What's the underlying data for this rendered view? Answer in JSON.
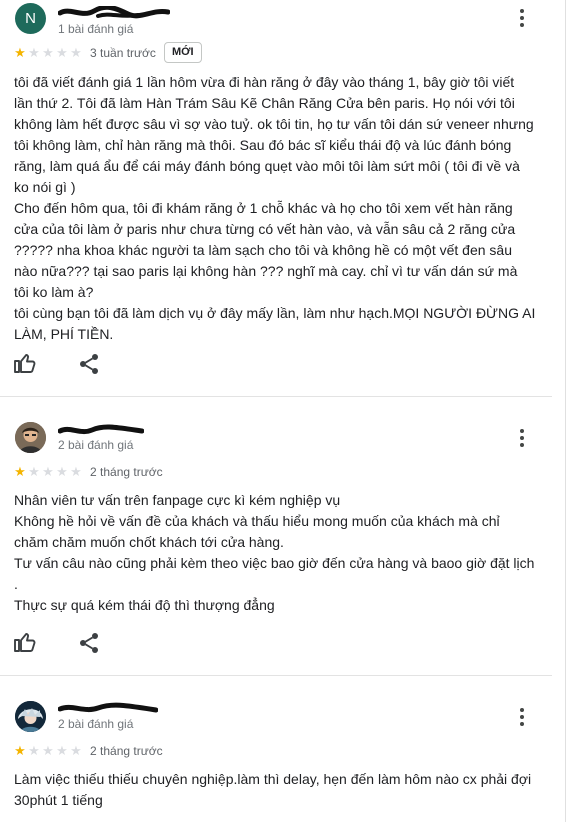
{
  "reviews": [
    {
      "avatar_letter": "N",
      "review_count": "1 bài đánh giá",
      "rating": 1,
      "time": "3 tuần trước",
      "badge": "MỚI",
      "text": "tôi đã viết đánh giá 1 lần hôm vừa đi hàn răng ở đây vào tháng 1, bây giờ tôi viết\nlần thứ 2. Tôi đã làm Hàn Trám Sâu Kẽ Chân Răng Cửa bên paris. Họ nói với tôi\nkhông làm hết được sâu vì sợ vào tuỷ. ok tôi tin, họ tư vấn tôi dán sứ veneer nhưng\ntôi không làm, chỉ hàn răng mà thôi. Sau đó bác sĩ kiểu thái độ và lúc đánh bóng\nrăng, làm quá ẩu để cái máy đánh bóng quẹt vào môi tôi làm sứt môi ( tôi đi về và\nko nói gì )\nCho đến hôm qua, tôi đi khám răng ở 1 chỗ khác và họ cho tôi xem vết hàn răng\ncửa của tôi làm ở paris như chưa từng có vết hàn vào, và vẫn sâu cả 2 răng cửa\n????? nha khoa khác người ta làm sạch cho tôi và không hề có một vết đen sâu\nnào nữa??? tại sao paris lại không hàn ??? nghĩ mà cay. chỉ vì tư vấn dán sứ mà\ntôi ko làm à?\ntôi cùng bạn tôi đã làm dịch vụ ở đây mấy lần, làm như hạch.MỌI NGƯỜI ĐỪNG AI\nLÀM, PHÍ TIỀN."
    },
    {
      "avatar_letter": "",
      "review_count": "2 bài đánh giá",
      "rating": 1,
      "time": "2 tháng trước",
      "badge": "",
      "text": "Nhân viên tư vấn trên fanpage cực kì kém nghiệp vụ\nKhông hề hỏi về vấn đề của khách và thấu hiểu mong muốn của khách mà chỉ\nchăm chăm muốn chốt khách tới cửa hàng.\nTư vấn câu nào cũng phải kèm theo việc bao giờ đến cửa hàng và baoo giờ đặt lịch\n.\nThực sự quá kém thái độ thì thượng đẳng"
    },
    {
      "avatar_letter": "",
      "review_count": "2 bài đánh giá",
      "rating": 1,
      "time": "2 tháng trước",
      "badge": "",
      "text": "Làm việc thiếu thiếu chuyên nghiệp.làm thì delay, hẹn đến làm hôm nào cx phải đợi\n30phút 1 tiếng"
    }
  ],
  "icons": {
    "more": "more-vert-icon",
    "like": "thumb-up-icon",
    "share": "share-icon",
    "star": "star-icon"
  },
  "colors": {
    "star_filled": "#f4b400",
    "star_empty": "#dadce0",
    "avatar_letter_bg": "#1e6a5b"
  }
}
